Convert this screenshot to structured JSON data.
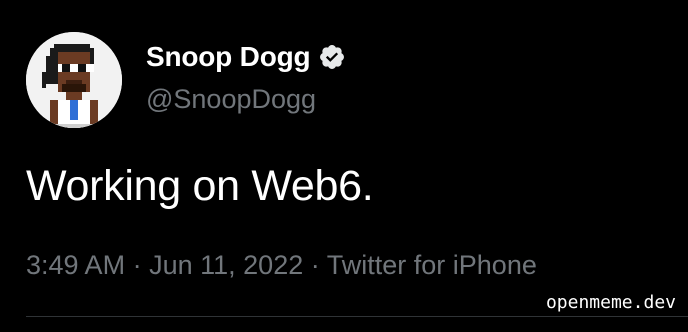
{
  "author": {
    "display_name": "Snoop Dogg",
    "handle": "@SnoopDogg",
    "verified": true
  },
  "tweet": {
    "text": "Working on Web6.",
    "time": "3:49 AM",
    "date": "Jun 11, 2022",
    "source": "Twitter for iPhone",
    "separator": "·"
  },
  "watermark": {
    "text": "openmeme.dev"
  },
  "icons": {
    "avatar": "pixel-art-avatar-icon",
    "verified": "verified-badge-icon"
  },
  "colors": {
    "background": "#000000",
    "primary_text": "#ffffff",
    "secondary_text": "#71767b",
    "divider": "#2f3336"
  }
}
